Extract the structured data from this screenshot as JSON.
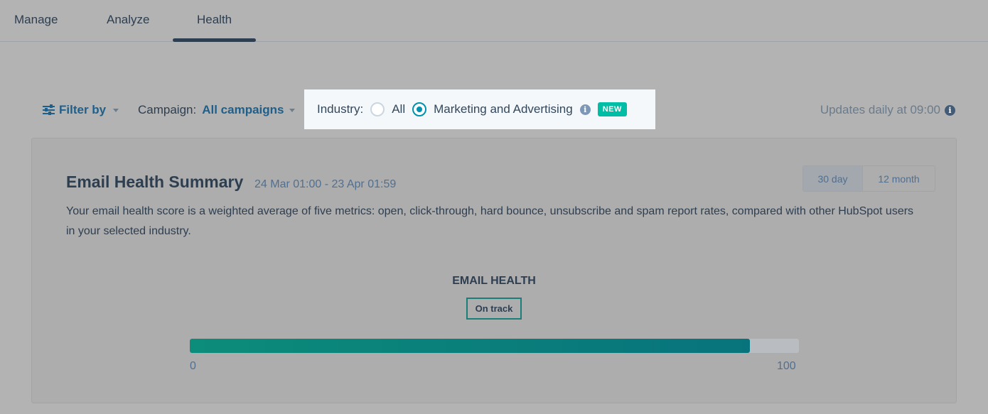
{
  "tabs": [
    {
      "label": "Manage"
    },
    {
      "label": "Analyze"
    },
    {
      "label": "Health",
      "active": true
    }
  ],
  "filters": {
    "filter_by_label": "Filter by",
    "campaign_label": "Campaign:",
    "campaign_value": "All campaigns",
    "industry_label": "Industry:",
    "industry_options": [
      {
        "label": "All",
        "checked": false
      },
      {
        "label": "Marketing and Advertising",
        "checked": true
      }
    ],
    "new_badge": "NEW",
    "updates_text": "Updates daily at 09:00"
  },
  "summary": {
    "title": "Email Health Summary",
    "date_range": "24 Mar 01:00 - 23 Apr 01:59",
    "description": "Your email health score is a weighted average of five metrics: open, click-through, hard bounce, unsubscribe and spam report rates, compared with other HubSpot users in your selected industry.",
    "range_options": [
      "30 day",
      "12 month"
    ],
    "range_selected": "30 day",
    "health_label": "EMAIL HEALTH",
    "status": "On track",
    "score_percent": 92,
    "scale_min": "0",
    "scale_max": "100"
  },
  "colors": {
    "accent": "#0091ae",
    "new_badge": "#00bda5",
    "bar_fill": "#0c8c7a"
  }
}
